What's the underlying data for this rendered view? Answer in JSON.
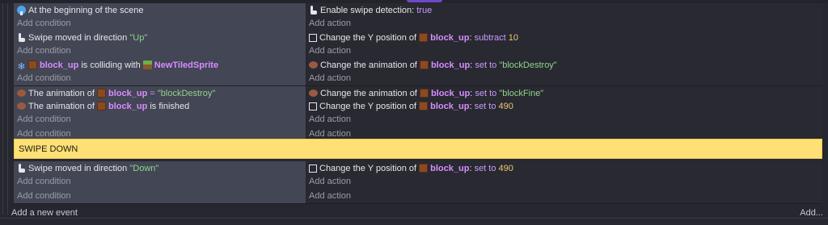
{
  "events": [
    {
      "conditions": [
        {
          "icon": "scene-start-icon",
          "text": "At the beginning of the scene"
        }
      ],
      "actions": [
        {
          "icon": "swipe-icon",
          "text": "Enable swipe detection:",
          "value": "true"
        }
      ]
    },
    {
      "conditions": [
        {
          "icon": "swipe-icon",
          "text": "Swipe moved in direction",
          "string": "\"Up\""
        }
      ],
      "actions": [
        {
          "icon": "position-icon",
          "text": "Change the Y position of",
          "object": "block_up",
          "op": "subtract",
          "number": "10"
        }
      ]
    },
    {
      "conditions": [
        {
          "icon": "collision-icon",
          "object": "block_up",
          "text": "is colliding with",
          "object2": "NewTiledSprite"
        }
      ],
      "actions": [
        {
          "icon": "animation-icon",
          "text": "Change the animation of",
          "object": "block_up",
          "op": "set to",
          "string": "\"blockDestroy\""
        }
      ]
    },
    {
      "conditions": [
        {
          "icon": "animation-icon",
          "text": "The animation of",
          "object": "block_up",
          "op": "=",
          "string": "\"blockDestroy\""
        },
        {
          "icon": "animation-icon",
          "text": "The animation of",
          "object": "block_up",
          "text2": "is finished"
        }
      ],
      "actions": [
        {
          "icon": "animation-icon",
          "text": "Change the animation of",
          "object": "block_up",
          "op": "set to",
          "string": "\"blockFine\""
        },
        {
          "icon": "position-icon",
          "text": "Change the Y position of",
          "object": "block_up",
          "op": "set to",
          "number": "490"
        }
      ]
    },
    {
      "conditions": [],
      "actions": []
    },
    {
      "conditions": [
        {
          "icon": "swipe-icon",
          "text": "Swipe moved in direction",
          "string": "\"Down\""
        }
      ],
      "actions": [
        {
          "icon": "position-icon",
          "text": "Change the Y position of",
          "object": "block_up",
          "op": "set to",
          "number": "490"
        }
      ]
    },
    {
      "conditions": [],
      "actions": []
    }
  ],
  "labels": {
    "add_condition": "Add condition",
    "add_action": "Add action",
    "add_event": "Add a new event",
    "add_more": "Add..."
  },
  "comment": "SWIPE DOWN",
  "colors": {
    "condition_bg": "#434654",
    "action_bg": "#282931",
    "comment_bg": "#ffe074",
    "string": "#8fd48a",
    "number": "#f0c674",
    "object": "#d88cff",
    "operator": "#c79cff"
  }
}
